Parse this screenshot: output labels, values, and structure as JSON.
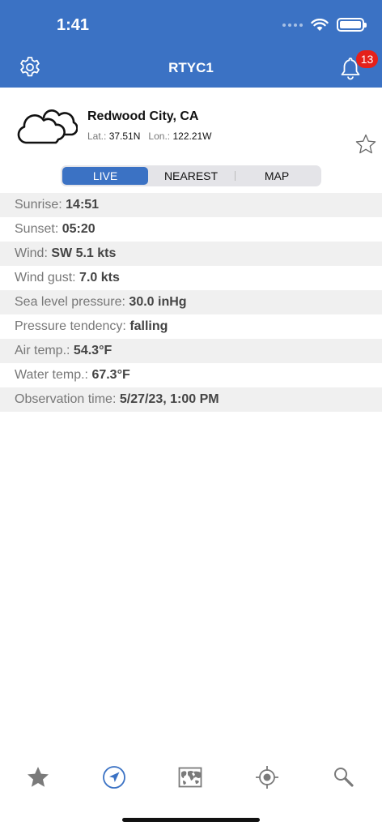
{
  "status_bar": {
    "time": "1:41"
  },
  "header": {
    "title": "RTYC1",
    "notification_count": "13"
  },
  "station": {
    "name": "Redwood City, CA",
    "lat_label": "Lat.:",
    "lat_value": "37.51N",
    "lon_label": "Lon.:",
    "lon_value": "122.21W",
    "weather_icon": "cloudy-icon"
  },
  "segments": [
    {
      "label": "LIVE",
      "active": true
    },
    {
      "label": "NEAREST",
      "active": false
    },
    {
      "label": "MAP",
      "active": false
    }
  ],
  "observations": [
    {
      "label": "Sunrise:",
      "value": "14:51"
    },
    {
      "label": "Sunset:",
      "value": "05:20"
    },
    {
      "label": "Wind:",
      "value": "SW 5.1 kts"
    },
    {
      "label": "Wind gust:",
      "value": "7.0 kts"
    },
    {
      "label": "Sea level pressure:",
      "value": "30.0 inHg"
    },
    {
      "label": "Pressure tendency:",
      "value": "falling"
    },
    {
      "label": "Air temp.:",
      "value": "54.3°F"
    },
    {
      "label": "Water temp.:",
      "value": "67.3°F"
    },
    {
      "label": "Observation time:",
      "value": "5/27/23, 1:00 PM"
    }
  ],
  "tabbar": {
    "items": [
      {
        "icon": "star-icon",
        "active": false
      },
      {
        "icon": "location-arrow-icon",
        "active": true
      },
      {
        "icon": "world-map-icon",
        "active": false
      },
      {
        "icon": "crosshair-icon",
        "active": false
      },
      {
        "icon": "search-icon",
        "active": false
      }
    ]
  },
  "colors": {
    "accent": "#3b72c4",
    "badge": "#e5211b",
    "row_alt": "#f0f0f0"
  }
}
